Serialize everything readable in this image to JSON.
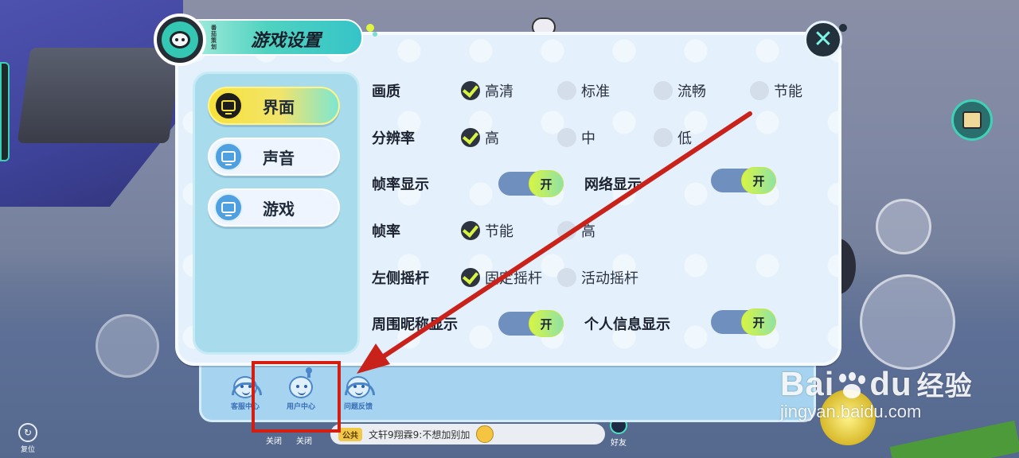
{
  "dialog": {
    "title": "游戏设置",
    "avatar_caption": "番茄策划",
    "close_symbol": "✕"
  },
  "tabs": [
    {
      "label": "界面",
      "active": true
    },
    {
      "label": "声音",
      "active": false
    },
    {
      "label": "游戏",
      "active": false
    }
  ],
  "settings": {
    "quality": {
      "label": "画质",
      "options": [
        "高清",
        "标准",
        "流畅",
        "节能"
      ],
      "selected": "高清"
    },
    "resolution": {
      "label": "分辨率",
      "options": [
        "高",
        "中",
        "低"
      ],
      "selected": "高"
    },
    "fps_display": {
      "label": "帧率显示",
      "toggle": "开"
    },
    "network_display": {
      "label": "网络显示",
      "toggle": "开"
    },
    "fps": {
      "label": "帧率",
      "options": [
        "节能",
        "高"
      ],
      "selected": "节能"
    },
    "left_joystick": {
      "label": "左侧摇杆",
      "options": [
        "固定摇杆",
        "活动摇杆"
      ],
      "selected": "固定摇杆"
    },
    "nickname_display": {
      "label": "周围昵称显示",
      "toggle": "开"
    },
    "personal_info_display": {
      "label": "个人信息显示",
      "toggle": "开"
    }
  },
  "service": {
    "items": [
      "客服中心",
      "用户中心",
      "问题反馈"
    ]
  },
  "hud": {
    "locate_label": "复位",
    "close_label_1": "关闭",
    "close_label_2": "关闭",
    "chat_tag": "公共",
    "chat_message": "文轩9翔霖9:不想加别加",
    "friend_label": "好友"
  },
  "watermark": {
    "brand_a": "Bai",
    "brand_b": "du",
    "brand_cn": "经验",
    "url": "jingyan.baidu.com"
  },
  "colors": {
    "accent_yellow": "#f7e23b",
    "accent_teal": "#4fd2c0",
    "annotation_red": "#d41e12"
  }
}
